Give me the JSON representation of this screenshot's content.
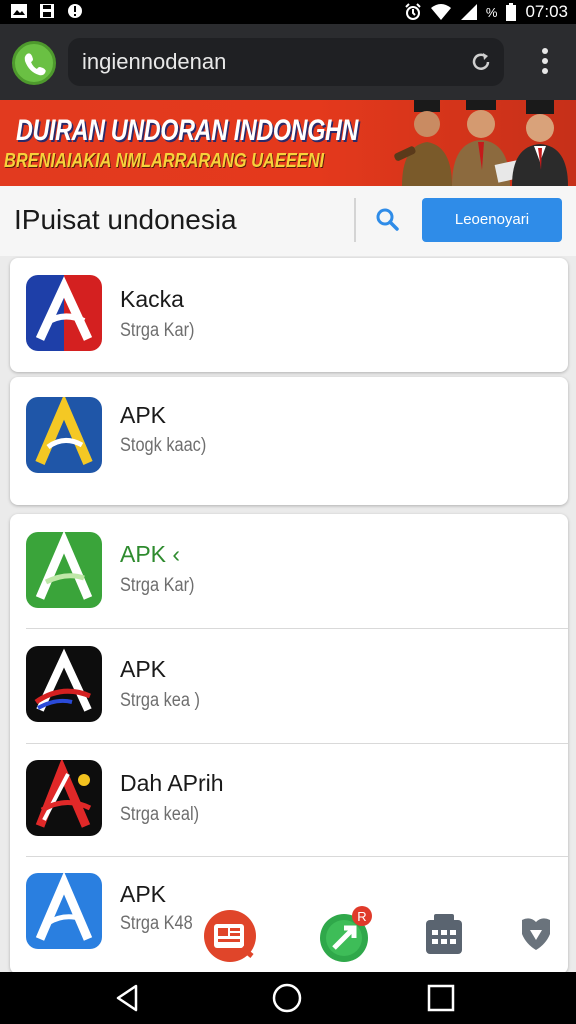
{
  "status_bar": {
    "time": "07:03",
    "battery_text": "%",
    "icons": [
      "image-icon",
      "save-icon",
      "alert-icon",
      "alarm-icon",
      "wifi-icon",
      "signal-icon",
      "battery-icon"
    ]
  },
  "browser": {
    "logo": "phone-logo-icon",
    "url": "ingiennodenan",
    "reload_icon": "reload-icon",
    "menu_icon": "more-vert-icon"
  },
  "banner": {
    "title": "DUIRAN UNDORAN INDONGHN",
    "subtitle": "BRENIAIAKIA NMLARRARANG UAEEENI",
    "colors": {
      "background": "#e23a1f",
      "title": "#ffffff",
      "subtitle": "#f7d23b"
    }
  },
  "search": {
    "title": "IPuisat undonesia",
    "search_icon": "search-icon",
    "login_label": "Leoenoyari"
  },
  "apps": [
    {
      "name": "Kacka",
      "sub": "Strga Kar)",
      "icon": "app-logo-red-blue",
      "name_color": "#1a1a1a"
    },
    {
      "name": "APK",
      "sub": "Stogk kaac)",
      "icon": "app-logo-yellow",
      "name_color": "#1a1a1a"
    },
    {
      "name": "APK ‹",
      "sub": "Strga Kar)",
      "icon": "app-logo-green",
      "name_color": "#2e8b2e"
    },
    {
      "name": "APK",
      "sub": "Strga kea )",
      "icon": "app-logo-dark-red",
      "name_color": "#1a1a1a"
    },
    {
      "name": "Dah APrih",
      "sub": "Strga keal)",
      "icon": "app-logo-dark-red-2",
      "name_color": "#1a1a1a"
    },
    {
      "name": "APK",
      "sub": "Strga K48",
      "icon": "app-logo-blue",
      "name_color": "#1a1a1a"
    }
  ],
  "floating_bar": {
    "icons": [
      "news-app-icon",
      "arrow-app-icon",
      "calendar-app-icon",
      "shield-app-icon"
    ],
    "badge": "R"
  },
  "nav_bar": {
    "icons": [
      "back-icon",
      "home-icon",
      "recents-icon"
    ]
  }
}
